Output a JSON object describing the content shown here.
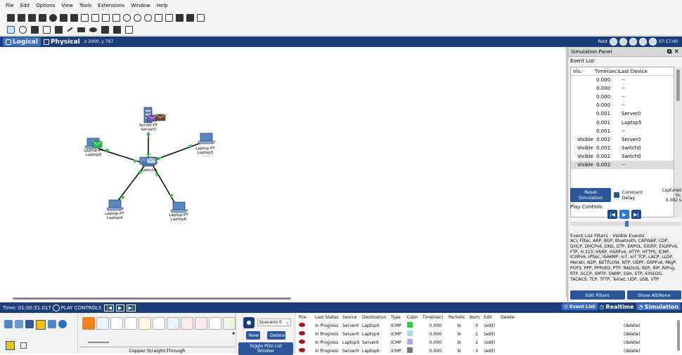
{
  "menu": [
    "File",
    "Edit",
    "Options",
    "View",
    "Tools",
    "Extensions",
    "Window",
    "Help"
  ],
  "help_symbol": "?",
  "tabs": {
    "logical": "Logical",
    "physical": "Physical",
    "coords": "x 2000, y 797"
  },
  "root": {
    "label": "Root",
    "time": "07:17:00"
  },
  "devices": [
    {
      "name": "Server0",
      "type": "Server-PT",
      "icon": "server-icon"
    },
    {
      "name": "Laptop0",
      "type": "Laptop-PT",
      "icon": "laptop-icon"
    },
    {
      "name": "Laptop5",
      "type": "Laptop-PT",
      "icon": "laptop-icon"
    },
    {
      "name": "Laptop4",
      "type": "Laptop-PT",
      "icon": "laptop-icon"
    },
    {
      "name": "Laptop6",
      "type": "Laptop-PT",
      "icon": "laptop-icon"
    },
    {
      "name": "Switch0",
      "type": "",
      "icon": "switch-icon"
    }
  ],
  "sim": {
    "title": "Simulation Panel",
    "event_list": "Event List",
    "headers": [
      "Vis.",
      "Time(sec)",
      "Last Device"
    ],
    "events": [
      {
        "vis": "",
        "time": "0.000",
        "dev": "--"
      },
      {
        "vis": "",
        "time": "0.000",
        "dev": "--"
      },
      {
        "vis": "",
        "time": "0.000",
        "dev": "--"
      },
      {
        "vis": "",
        "time": "0.000",
        "dev": "--"
      },
      {
        "vis": "",
        "time": "0.001",
        "dev": "Server0"
      },
      {
        "vis": "",
        "time": "0.001",
        "dev": "Laptop5"
      },
      {
        "vis": "",
        "time": "0.001",
        "dev": "--"
      },
      {
        "vis": "Visible",
        "time": "0.002",
        "dev": "Server0"
      },
      {
        "vis": "Visible",
        "time": "0.002",
        "dev": "Switch0"
      },
      {
        "vis": "Visible",
        "time": "0.002",
        "dev": "Switch0"
      },
      {
        "vis": "Visible",
        "time": "0.002",
        "dev": "--"
      }
    ],
    "reset": "Reset Simulation",
    "constant_delay": "Constant Delay",
    "captured_label": "Captured to:",
    "captured_value": "0.002 s",
    "play_controls": "Play Controls",
    "filters_title": "Event List Filters - Visible Events",
    "filters_text": "ACL Filter, ARP, BGP, Bluetooth, CAPWAP, CDP, DHCP, DHCPv6, DNS, DTP, EAPOL, EIGRP, EIGRPv6, FTP, H.323, HSRP, HSRPv6, HTTP, HTTPS, ICMP, ICMPv6, IPSec, ISAKMP, IoT, IoT TCP, LACP, LLDP, Meraki, NDP, NETFLOW, NTP, OSPF, OSPFv6, PAgP, POP3, PPP, PPPoED, PTP, RADIUS, REP, RIP, RIPng, RTP, SCCP, SMTP, SNMP, SSH, STP, SYSLOG, TACACS, TCP, TFTP, Telnet, UDP, USB, VTP",
    "edit_filters": "Edit Filters",
    "show_all": "Show All/None"
  },
  "bottom": {
    "time": "Time: 01:00:51.017",
    "play_controls": "PLAY CONTROLS",
    "event_list": "Event List",
    "realtime": "Realtime",
    "simulation": "Simulation"
  },
  "cable_label": "Copper Straight-Through",
  "scenario": {
    "value": "Scenario 0",
    "new": "New",
    "delete": "Delete",
    "toggle": "Toggle PDU List Window"
  },
  "pdu": {
    "headers": [
      "Fire",
      "Last Status",
      "Source",
      "Destination",
      "Type",
      "Color",
      "Time(sec)",
      "Periodic",
      "Num",
      "Edit",
      "Delete"
    ],
    "rows": [
      {
        "status": "In Progress",
        "src": "Server0",
        "dst": "Laptop0",
        "type": "ICMP",
        "color": "#2ecc40",
        "time": "0.000",
        "periodic": "N",
        "num": "0",
        "edit": "(edit)",
        "del": "(delete)"
      },
      {
        "status": "In Progress",
        "src": "Server0",
        "dst": "Laptop4",
        "type": "ICMP",
        "color": "#a8d8f0",
        "time": "0.000",
        "periodic": "N",
        "num": "1",
        "edit": "(edit)",
        "del": "(delete)"
      },
      {
        "status": "In Progress",
        "src": "Laptop5",
        "dst": "Server0",
        "type": "ICMP",
        "color": "#b9a4e6",
        "time": "0.000",
        "periodic": "N",
        "num": "2",
        "edit": "(edit)",
        "del": "(delete)"
      },
      {
        "status": "In Progress",
        "src": "Server0",
        "dst": "Laptop6",
        "type": "ICMP",
        "color": "#777777",
        "time": "0.000",
        "periodic": "N",
        "num": "3",
        "edit": "(edit)",
        "del": "(delete)"
      }
    ]
  }
}
